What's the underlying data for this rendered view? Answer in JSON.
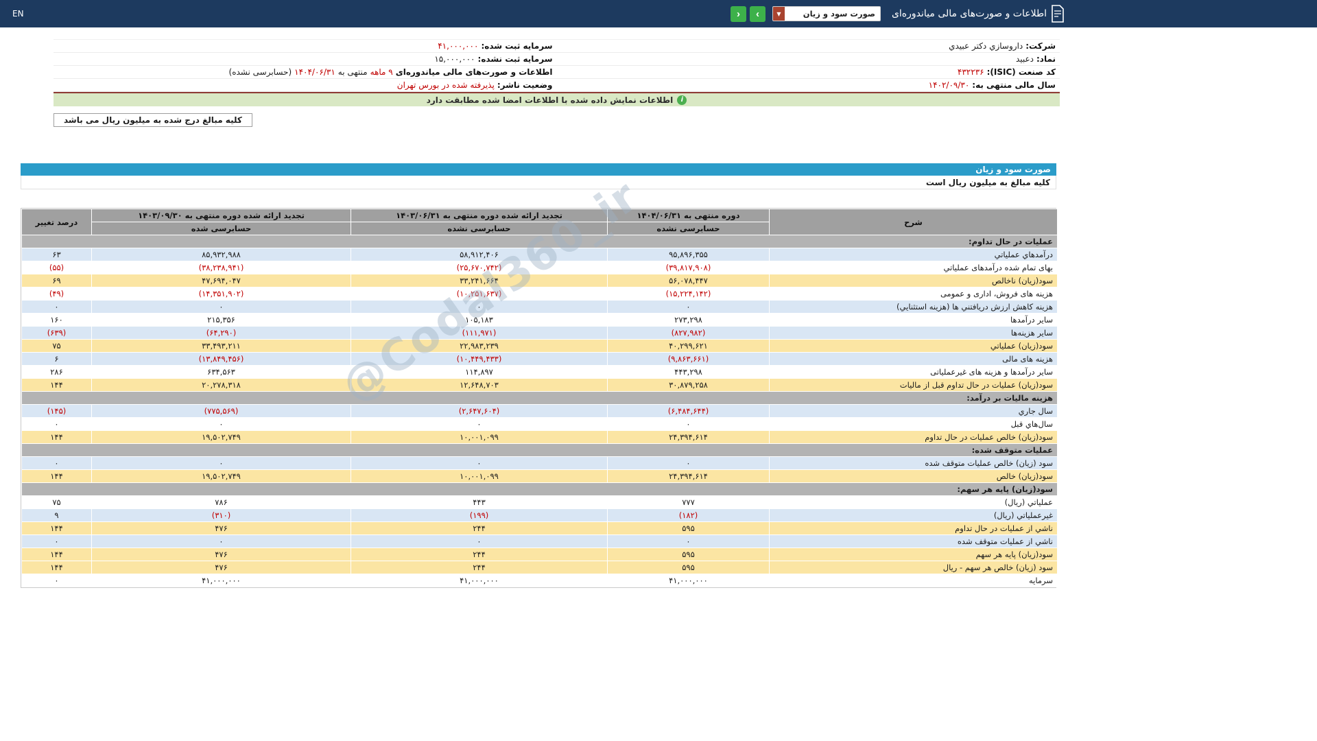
{
  "topbar": {
    "title": "اطلاعات و صورت‌های مالی میاندوره‌ای",
    "report_dropdown": {
      "value": "صورت سود و زیان",
      "caret": "▼"
    },
    "nav_forward": "›",
    "nav_back": "‹",
    "language": "EN"
  },
  "company": {
    "right": [
      {
        "label": "شرکت:",
        "parts": [
          {
            "t": "داروسازي دکتر عبيدي",
            "red": false
          }
        ]
      },
      {
        "label": "نماد:",
        "parts": [
          {
            "t": "دعبيد",
            "red": false
          }
        ]
      },
      {
        "label": "کد صنعت (ISIC):",
        "parts": [
          {
            "t": "۴۳۲۲۳۶",
            "red": true
          }
        ]
      },
      {
        "label": "سال مالی منتهی به:",
        "parts": [
          {
            "t": "۱۴۰۲/۰۹/۳۰",
            "red": true
          }
        ]
      }
    ],
    "left": [
      {
        "label": "سرمایه ثبت شده:",
        "parts": [
          {
            "t": "۴۱,۰۰۰,۰۰۰",
            "red": true
          }
        ]
      },
      {
        "label": "سرمایه ثبت نشده:",
        "parts": [
          {
            "t": "۱۵,۰۰۰,۰۰۰",
            "red": false
          }
        ]
      },
      {
        "label": "اطلاعات و صورت‌های مالی میاندوره‌ای",
        "parts": [
          {
            "t": "۹ ماهه",
            "red": true
          },
          {
            "t": "منتهی به",
            "red": false
          },
          {
            "t": "۱۴۰۴/۰۶/۳۱",
            "red": true
          },
          {
            "t": "(حسابرسی نشده)",
            "red": false
          }
        ]
      },
      {
        "label": "وضعیت ناشر:",
        "parts": [
          {
            "t": "پذیرفته شده در بورس تهران",
            "red": true
          }
        ]
      }
    ]
  },
  "banner": {
    "text": "اطلاعات نمایش داده شده با اطلاعات امضا شده مطابقت دارد",
    "icon": "i"
  },
  "amount_note": "کلیه مبالغ درج شده به میلیون ریال می باشد",
  "statement": {
    "title": "صورت سود و زیان",
    "unit_note": "کلیه مبالغ به میلیون ریال است",
    "watermark": "@Codal360_ir",
    "columns": {
      "desc": "شرح",
      "c1": {
        "title": "دوره منتهی به ۱۴۰۴/۰۶/۳۱",
        "sub": "حسابرسی نشده"
      },
      "c2": {
        "title": "تجدید ارائه شده دوره منتهی به ۱۴۰۳/۰۶/۳۱",
        "sub": "حسابرسی نشده"
      },
      "c3": {
        "title": "تجدید ارائه شده دوره منتهی به ۱۴۰۳/۰۹/۳۰",
        "sub": "حسابرسی شده"
      },
      "pct": "درصد تغییر"
    },
    "rows": [
      {
        "type": "section",
        "label": "عملیات در حال تداوم:"
      },
      {
        "type": "data",
        "style": "blue",
        "label": "درآمدهاي عملياتي",
        "values": [
          "۹۵,۸۹۶,۳۵۵",
          "۵۸,۹۱۲,۴۰۶",
          "۸۵,۹۳۲,۹۸۸",
          "۶۳"
        ]
      },
      {
        "type": "data",
        "style": "white",
        "label": "بهاى تمام شده درآمدهاى عملياتي",
        "values": [
          "(۳۹,۸۱۷,۹۰۸)",
          "(۲۵,۶۷۰,۷۴۲)",
          "(۳۸,۲۳۸,۹۴۱)",
          "(۵۵)"
        ]
      },
      {
        "type": "data",
        "style": "yellow",
        "label": "سود(زيان) ناخالص",
        "values": [
          "۵۶,۰۷۸,۴۴۷",
          "۳۳,۲۴۱,۶۶۴",
          "۴۷,۶۹۴,۰۴۷",
          "۶۹"
        ]
      },
      {
        "type": "data",
        "style": "white",
        "label": "هزينه هاى فروش، ادارى و عمومى",
        "values": [
          "(۱۵,۲۲۴,۱۴۲)",
          "(۱۰,۲۵۱,۶۳۷)",
          "(۱۴,۳۵۱,۹۰۲)",
          "(۴۹)"
        ]
      },
      {
        "type": "data",
        "style": "blue",
        "label": "هزينه کاهش ارزش دريافتني ها (هزينه استثنايي)",
        "values": [
          "۰",
          "۰",
          "۰",
          "۰"
        ]
      },
      {
        "type": "data",
        "style": "white",
        "label": "ساير درآمدها",
        "values": [
          "۲۷۳,۲۹۸",
          "۱۰۵,۱۸۳",
          "۲۱۵,۳۵۶",
          "۱۶۰"
        ]
      },
      {
        "type": "data",
        "style": "blue",
        "label": "ساير هزينه‌ها",
        "values": [
          "(۸۲۷,۹۸۲)",
          "(۱۱۱,۹۷۱)",
          "(۶۴,۲۹۰)",
          "(۶۳۹)"
        ]
      },
      {
        "type": "data",
        "style": "yellow",
        "label": "سود(زيان) عملياتي",
        "values": [
          "۴۰,۲۹۹,۶۲۱",
          "۲۲,۹۸۳,۲۳۹",
          "۳۳,۴۹۳,۲۱۱",
          "۷۵"
        ]
      },
      {
        "type": "data",
        "style": "blue",
        "label": "هزينه هاى مالى",
        "values": [
          "(۹,۸۶۳,۶۶۱)",
          "(۱۰,۴۴۹,۴۳۳)",
          "(۱۳,۸۴۹,۴۵۶)",
          "۶"
        ]
      },
      {
        "type": "data",
        "style": "white",
        "label": "ساير درآمدها و هزينه هاى غيرعملياتى",
        "values": [
          "۴۴۳,۲۹۸",
          "۱۱۴,۸۹۷",
          "۶۳۴,۵۶۳",
          "۲۸۶"
        ]
      },
      {
        "type": "data",
        "style": "yellow",
        "label": "سود(زيان) عمليات در حال تداوم قبل از ماليات",
        "values": [
          "۳۰,۸۷۹,۲۵۸",
          "۱۲,۶۴۸,۷۰۳",
          "۲۰,۲۷۸,۳۱۸",
          "۱۴۴"
        ]
      },
      {
        "type": "section",
        "label": "هزينه ماليات بر درآمد:"
      },
      {
        "type": "data",
        "style": "blue",
        "label": "سال جاري",
        "values": [
          "(۶,۴۸۴,۶۴۴)",
          "(۲,۶۴۷,۶۰۴)",
          "(۷۷۵,۵۶۹)",
          "(۱۴۵)"
        ]
      },
      {
        "type": "data",
        "style": "white",
        "label": "سال‌هاي قبل",
        "values": [
          "۰",
          "۰",
          "۰",
          "۰"
        ]
      },
      {
        "type": "data",
        "style": "yellow",
        "label": "سود(زيان) خالص عمليات در حال تداوم",
        "values": [
          "۲۴,۳۹۴,۶۱۴",
          "۱۰,۰۰۱,۰۹۹",
          "۱۹,۵۰۲,۷۴۹",
          "۱۴۴"
        ]
      },
      {
        "type": "section",
        "label": "عمليات متوقف شده:"
      },
      {
        "type": "data",
        "style": "blue",
        "label": "سود (زيان) خالص عمليات متوقف شده",
        "values": [
          "۰",
          "۰",
          "۰",
          "۰"
        ]
      },
      {
        "type": "data",
        "style": "yellow",
        "label": "سود(زيان) خالص",
        "values": [
          "۲۴,۳۹۴,۶۱۴",
          "۱۰,۰۰۱,۰۹۹",
          "۱۹,۵۰۲,۷۴۹",
          "۱۴۴"
        ]
      },
      {
        "type": "section",
        "label": "سود(زيان) پايه هر سهم:"
      },
      {
        "type": "data",
        "style": "white",
        "label": "عملياتي (ريال)",
        "values": [
          "۷۷۷",
          "۴۴۳",
          "۷۸۶",
          "۷۵"
        ]
      },
      {
        "type": "data",
        "style": "blue",
        "label": "غيرعملياتي (ريال)",
        "values": [
          "(۱۸۲)",
          "(۱۹۹)",
          "(۳۱۰)",
          "۹"
        ]
      },
      {
        "type": "data",
        "style": "yellow",
        "label": "ناشي از عمليات در حال تداوم",
        "values": [
          "۵۹۵",
          "۲۴۴",
          "۴۷۶",
          "۱۴۴"
        ]
      },
      {
        "type": "data",
        "style": "blue",
        "label": "ناشي از عمليات متوقف شده",
        "values": [
          "۰",
          "۰",
          "۰",
          "۰"
        ]
      },
      {
        "type": "data",
        "style": "yellow",
        "label": "سود(زيان) پايه هر سهم",
        "values": [
          "۵۹۵",
          "۲۴۴",
          "۴۷۶",
          "۱۴۴"
        ]
      },
      {
        "type": "data",
        "style": "yellow",
        "label": "سود (زيان) خالص هر سهم - ريال",
        "values": [
          "۵۹۵",
          "۲۴۴",
          "۴۷۶",
          "۱۴۴"
        ]
      },
      {
        "type": "data",
        "style": "white",
        "label": "سرمايه",
        "values": [
          "۴۱,۰۰۰,۰۰۰",
          "۴۱,۰۰۰,۰۰۰",
          "۴۱,۰۰۰,۰۰۰",
          "۰"
        ]
      }
    ]
  },
  "colors": {
    "navy": "#1d3a5f",
    "accent_blue": "#2b9cc9",
    "green_button": "#3db14a",
    "banner_green": "#d9e8c4",
    "row_blue": "#d9e6f4",
    "row_yellow": "#fbe5a3",
    "section_gray": "#b3b3b3",
    "negative_red": "#c00000"
  }
}
